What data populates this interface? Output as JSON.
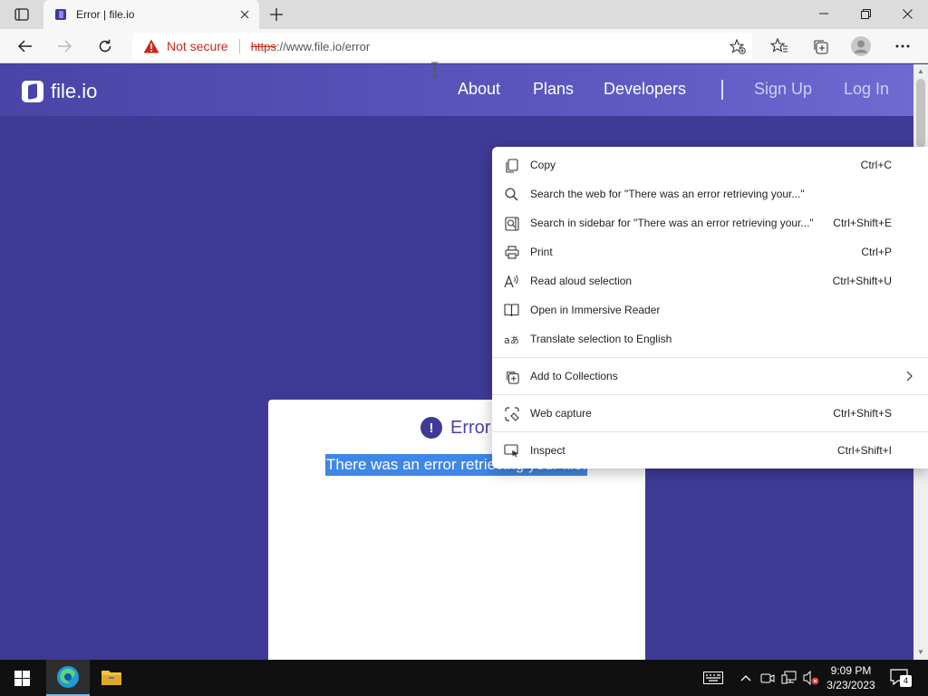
{
  "browser": {
    "tab": {
      "title": "Error | file.io"
    },
    "address": {
      "security_label": "Not secure",
      "url_scheme": "https",
      "url_rest": "://www.file.io/error"
    }
  },
  "site": {
    "logo_text": "file.io",
    "nav": [
      {
        "label": "About"
      },
      {
        "label": "Plans"
      },
      {
        "label": "Developers"
      },
      {
        "label": "Sign Up"
      },
      {
        "label": "Log In"
      }
    ]
  },
  "error_card": {
    "heading": "Error",
    "message": "There was an error retrieving your file."
  },
  "context_menu": {
    "items": [
      {
        "label": "Copy",
        "shortcut": "Ctrl+C",
        "icon": "copy-icon"
      },
      {
        "label": "Search the web for \"There was an error retrieving your...\"",
        "shortcut": "",
        "icon": "search-icon"
      },
      {
        "label": "Search in sidebar for \"There was an error retrieving your...\"",
        "shortcut": "Ctrl+Shift+E",
        "icon": "sidebar-search-icon"
      },
      {
        "label": "Print",
        "shortcut": "Ctrl+P",
        "icon": "print-icon"
      },
      {
        "label": "Read aloud selection",
        "shortcut": "Ctrl+Shift+U",
        "icon": "read-aloud-icon"
      },
      {
        "label": "Open in Immersive Reader",
        "shortcut": "",
        "icon": "immersive-reader-icon"
      },
      {
        "label": "Translate selection to English",
        "shortcut": "",
        "icon": "translate-icon"
      },
      {
        "label": "Add to Collections",
        "shortcut": "",
        "icon": "collections-icon"
      },
      {
        "label": "Web capture",
        "shortcut": "Ctrl+Shift+S",
        "icon": "web-capture-icon"
      },
      {
        "label": "Inspect",
        "shortcut": "Ctrl+Shift+I",
        "icon": "inspect-icon"
      }
    ]
  },
  "taskbar": {
    "time": "9:09 PM",
    "date": "3/23/2023",
    "notification_count": "4"
  },
  "colors": {
    "page_background": "#3f3a96",
    "header_accent": "#5f5ac2",
    "selection": "#3f86e6",
    "not_secure_red": "#c42b1c"
  }
}
